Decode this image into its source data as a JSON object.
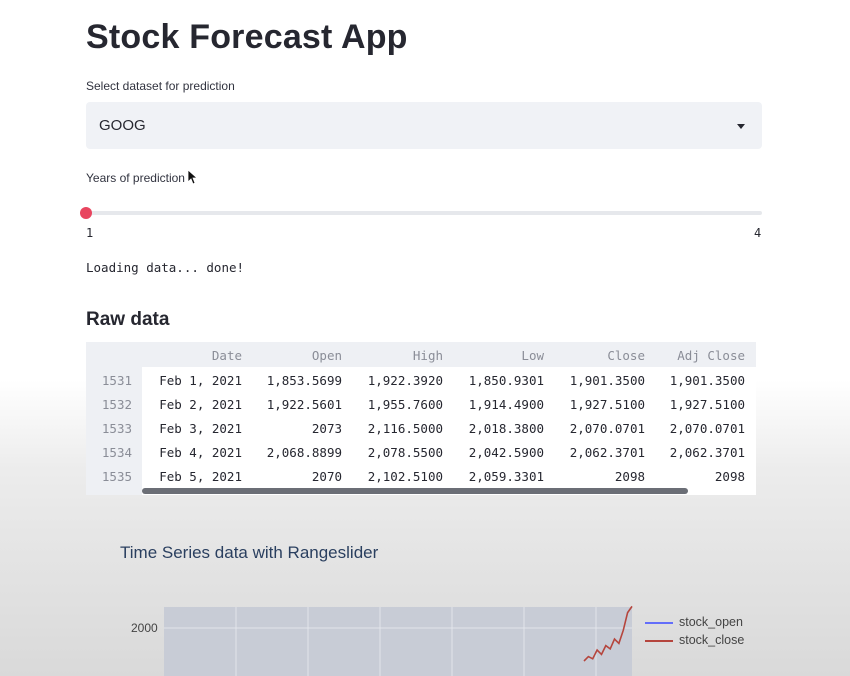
{
  "app": {
    "title": "Stock Forecast App"
  },
  "dataset_select": {
    "label": "Select dataset for prediction",
    "value": "GOOG"
  },
  "years_slider": {
    "label": "Years of prediction",
    "min": "1",
    "max": "4",
    "value": 1
  },
  "status": {
    "text": "Loading data... done!"
  },
  "raw_data": {
    "heading": "Raw data",
    "columns": [
      "Date",
      "Open",
      "High",
      "Low",
      "Close",
      "Adj Close"
    ],
    "rows": [
      {
        "index": "1531",
        "cells": [
          "Feb 1, 2021",
          "1,853.5699",
          "1,922.3920",
          "1,850.9301",
          "1,901.3500",
          "1,901.3500"
        ]
      },
      {
        "index": "1532",
        "cells": [
          "Feb 2, 2021",
          "1,922.5601",
          "1,955.7600",
          "1,914.4900",
          "1,927.5100",
          "1,927.5100"
        ]
      },
      {
        "index": "1533",
        "cells": [
          "Feb 3, 2021",
          "2073",
          "2,116.5000",
          "2,018.3800",
          "2,070.0701",
          "2,070.0701"
        ]
      },
      {
        "index": "1534",
        "cells": [
          "Feb 4, 2021",
          "2,068.8899",
          "2,078.5500",
          "2,042.5900",
          "2,062.3701",
          "2,062.3701"
        ]
      },
      {
        "index": "1535",
        "cells": [
          "Feb 5, 2021",
          "2070",
          "2,102.5100",
          "2,059.3301",
          "2098",
          "2098"
        ]
      }
    ]
  },
  "chart": {
    "title": "Time Series data with Rangeslider",
    "ytick": "2000",
    "colors": {
      "open": "#636efa",
      "close": "#b5453d"
    },
    "legend": [
      "stock_open",
      "stock_close"
    ]
  },
  "chart_data": {
    "type": "line",
    "title": "Time Series data with Rangeslider",
    "yticks": [
      2000
    ],
    "series": [
      {
        "name": "stock_open",
        "values": []
      },
      {
        "name": "stock_close",
        "values": [
          1850,
          1870,
          1860,
          1900,
          1880,
          1920,
          1905,
          1950,
          1930,
          1990,
          2070,
          2098
        ]
      }
    ]
  }
}
